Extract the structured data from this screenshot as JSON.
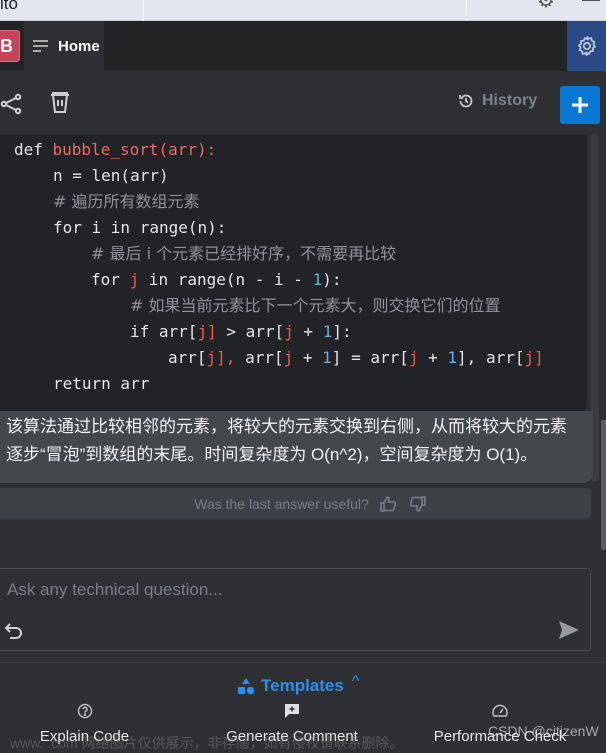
{
  "window": {
    "title_fragment": "ito"
  },
  "tabbar": {
    "badge_letter": "B",
    "home_label": "Home"
  },
  "toolbar": {
    "history_label": "History"
  },
  "code": {
    "language": "python",
    "lines": [
      {
        "indent": 0,
        "text": "def bubble_sort(arr):"
      },
      {
        "indent": 1,
        "text": "n = len(arr)"
      },
      {
        "indent": 1,
        "text": "# 遍历所有数组元素"
      },
      {
        "indent": 1,
        "text": "for i in range(n):"
      },
      {
        "indent": 2,
        "text": "# 最后 i 个元素已经排好序，不需要再比较"
      },
      {
        "indent": 2,
        "text": "for j in range(n - i - 1):"
      },
      {
        "indent": 3,
        "text": "# 如果当前元素比下一个元素大，则交换它们的位置"
      },
      {
        "indent": 3,
        "text": "if arr[j] > arr[j + 1]:"
      },
      {
        "indent": 4,
        "text": "arr[j], arr[j + 1] = arr[j + 1], arr[j]"
      },
      {
        "indent": 1,
        "text": "return arr"
      }
    ],
    "keyword_def": "def ",
    "fn_name": "bubble_sort(arr):",
    "line2": "n = len(arr)",
    "comment1": "# 遍历所有数组元素",
    "line4": "for i in range(n):",
    "comment2": "# 最后 i 个元素已经排好序，不需要再比较",
    "comment3": "# 如果当前元素比下一个元素大，则交换它们的位置",
    "return_line": "return arr"
  },
  "answer": {
    "line1": "该算法通过比较相邻的元素，将较大的元素交换到右侧，从而将较大的元素",
    "line2": "逐步“冒泡”到数组的末尾。时间复杂度为 O(n^2)，空间复杂度为 O(1)。"
  },
  "feedback": {
    "question": "Was the last answer useful?"
  },
  "input": {
    "placeholder": "Ask any technical question...",
    "value": ""
  },
  "templates": {
    "label": "Templates",
    "caret": "^",
    "items": [
      {
        "label": "Explain Code",
        "icon": "question-bubble-icon"
      },
      {
        "label": "Generate Comment",
        "icon": "comment-plus-icon"
      },
      {
        "label": "Performance Check",
        "icon": "speedometer-icon"
      }
    ]
  },
  "watermark": {
    "text": "www.          .com 网络图片仅供展示，非存储，如有侵权请联系删除。",
    "credit": "CSDN @citizenW"
  },
  "colors": {
    "accent_blue": "#0b78d4",
    "templates_blue": "#2f8ee8",
    "badge_red": "#c7435a",
    "settings_bg": "#2a4a85",
    "code_fn": "#ef6a5e",
    "code_num": "#6aaee8"
  }
}
